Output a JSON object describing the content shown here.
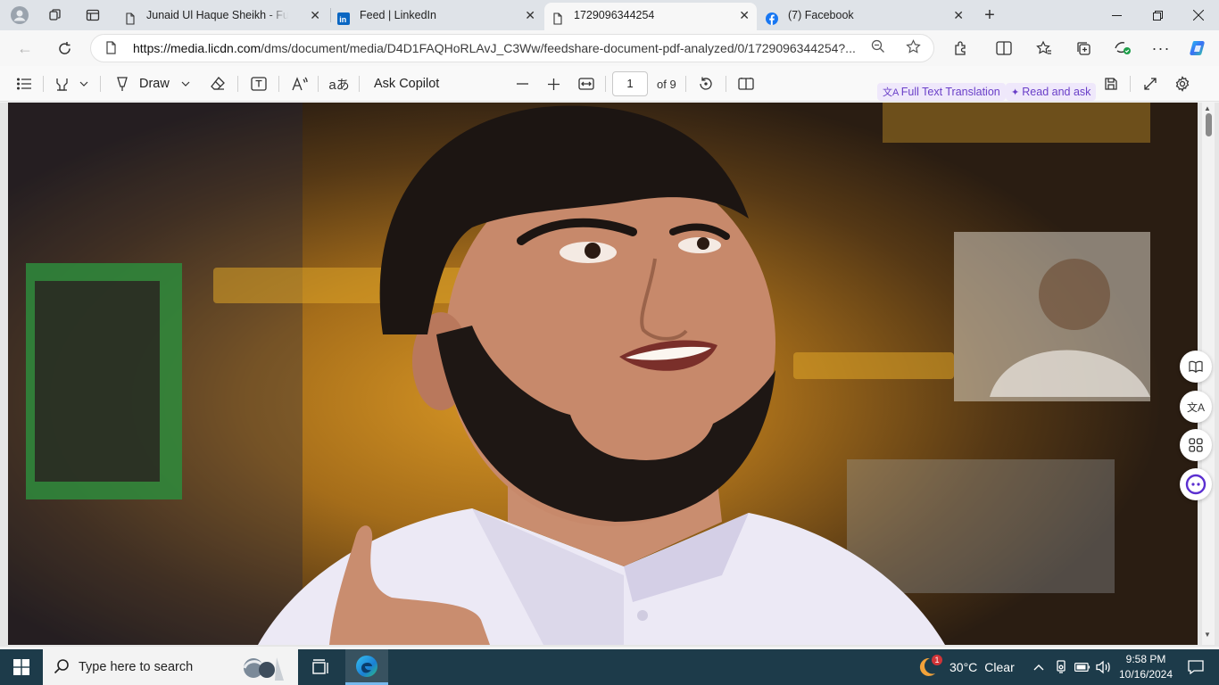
{
  "tabs": [
    {
      "title": "Junaid Ul Haque Sheikh - Full Stack",
      "favicon": "page-icon",
      "active": false
    },
    {
      "title": "Feed | LinkedIn",
      "favicon": "linkedin-icon",
      "active": false
    },
    {
      "title": "1729096344254",
      "favicon": "page-icon",
      "active": true
    },
    {
      "title": "(7) Facebook",
      "favicon": "facebook-icon",
      "active": false
    }
  ],
  "address": {
    "url_host": "https://media.licdn.com",
    "url_path": "/dms/document/media/D4D1FAQHoRLAvJ_C3Ww/feedshare-document-pdf-analyzed/0/1729096344254?..."
  },
  "pdf_toolbar": {
    "draw_label": "Draw",
    "ask_copilot_label": "Ask Copilot",
    "current_page": "1",
    "page_total": "of 9",
    "full_text_translation_label": "Full Text Translation",
    "read_and_ask_label": "Read and ask"
  },
  "taskbar": {
    "search_placeholder": "Type here to search",
    "weather_temp": "30°C",
    "weather_condition": "Clear",
    "notification_badge": "1",
    "time": "9:58 PM",
    "date": "10/16/2024"
  },
  "colors": {
    "accent_purple": "#6a3fc8",
    "taskbar_bg": "#1d3b4a",
    "linkedin_blue": "#0a66c2",
    "facebook_blue": "#1877f2",
    "copilot_ring": "#5b2fd0"
  }
}
